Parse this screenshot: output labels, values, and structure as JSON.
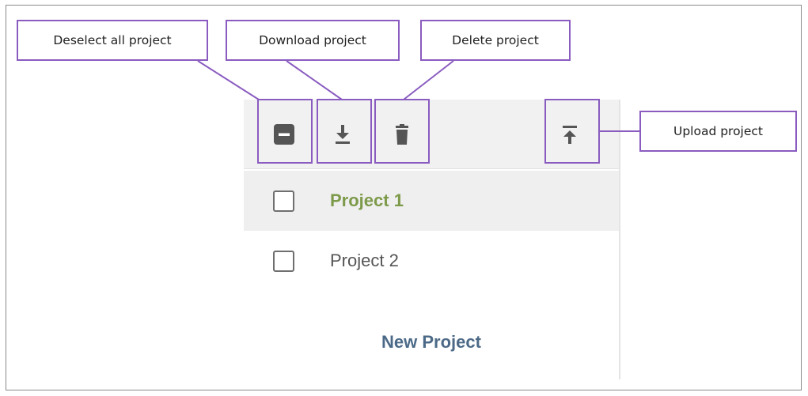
{
  "callouts": {
    "deselect": "Deselect all project",
    "download": "Download project",
    "delete": "Delete  project",
    "upload": "Upload project"
  },
  "toolbar": {
    "icons": [
      "deselect-all-icon",
      "download-icon",
      "trash-icon",
      "upload-icon"
    ]
  },
  "projects": [
    {
      "label": "Project 1",
      "selected": true
    },
    {
      "label": "Project 2",
      "selected": false
    }
  ],
  "new_project_label": "New Project",
  "colors": {
    "callout_border": "#8a5cc0",
    "selected_label": "#7d9a4a",
    "new_project": "#4c6a87",
    "icon": "#555555"
  }
}
